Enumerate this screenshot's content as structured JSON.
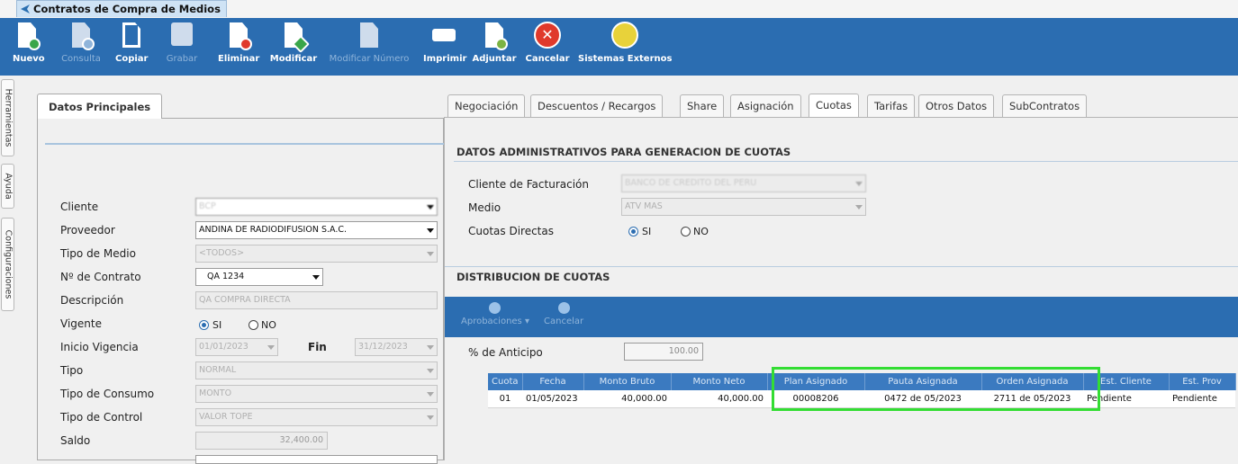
{
  "window": {
    "title": "Contratos de Compra de Medios"
  },
  "toolbar": {
    "buttons": [
      {
        "label": "Nuevo",
        "icon": "new-document-icon",
        "enabled": true
      },
      {
        "label": "Consulta",
        "icon": "query-document-icon",
        "enabled": false
      },
      {
        "label": "Copiar",
        "icon": "copy-icon",
        "enabled": true
      },
      {
        "label": "Grabar",
        "icon": "save-icon",
        "enabled": false
      },
      {
        "label": "Eliminar",
        "icon": "delete-document-icon",
        "enabled": true
      },
      {
        "label": "Modificar",
        "icon": "edit-document-icon",
        "enabled": true
      },
      {
        "label": "Modificar Número",
        "icon": "edit-number-icon",
        "enabled": false
      },
      {
        "label": "Imprimir",
        "icon": "printer-icon",
        "enabled": true
      },
      {
        "label": "Adjuntar",
        "icon": "attach-icon",
        "enabled": true
      },
      {
        "label": "Cancelar",
        "icon": "cancel-icon",
        "enabled": true
      },
      {
        "label": "Sistemas Externos",
        "icon": "external-systems-icon",
        "enabled": true
      }
    ]
  },
  "sidebar": {
    "tabs": [
      "Herramientas",
      "Ayuda",
      "Configuraciones"
    ]
  },
  "left_panel": {
    "tab": "Datos Principales",
    "fields": {
      "cliente": {
        "label": "Cliente",
        "value": "BCP"
      },
      "proveedor": {
        "label": "Proveedor",
        "value": "ANDINA DE RADIODIFUSION S.A.C."
      },
      "tipo_medio": {
        "label": "Tipo de Medio",
        "value": "<TODOS>"
      },
      "nro_contrato": {
        "label": "Nº de Contrato",
        "value": "QA 1234"
      },
      "descripcion": {
        "label": "Descripción",
        "value": "QA COMPRA DIRECTA"
      },
      "vigente": {
        "label": "Vigente",
        "yes": "SI",
        "no": "NO",
        "selected": "SI"
      },
      "inicio_vigencia": {
        "label": "Inicio Vigencia",
        "value": "01/01/2023"
      },
      "fin": {
        "label": "Fin",
        "value": "31/12/2023"
      },
      "tipo": {
        "label": "Tipo",
        "value": "NORMAL"
      },
      "tipo_consumo": {
        "label": "Tipo de Consumo",
        "value": "MONTO"
      },
      "tipo_control": {
        "label": "Tipo de Control",
        "value": "VALOR TOPE"
      },
      "saldo": {
        "label": "Saldo",
        "value": "32,400.00"
      }
    }
  },
  "right_panel": {
    "tabs": [
      "Negociación",
      "Descuentos / Recargos",
      "Share",
      "Asignación",
      "Cuotas",
      "Tarifas",
      "Otros Datos",
      "SubContratos"
    ],
    "active_tab": "Cuotas",
    "admin_section": {
      "title": "DATOS ADMINISTRATIVOS PARA GENERACION DE CUOTAS",
      "cliente_facturacion": {
        "label": "Cliente de Facturación",
        "value": "BANCO DE CREDITO DEL PERU"
      },
      "medio": {
        "label": "Medio",
        "value": "ATV MAS"
      },
      "cuotas_directas": {
        "label": "Cuotas Directas",
        "yes": "SI",
        "no": "NO",
        "selected": "SI"
      }
    },
    "distribution_section": {
      "title": "DISTRIBUCION DE CUOTAS",
      "actions": [
        {
          "label": "Aprobaciones ▾",
          "icon": "approvals-icon"
        },
        {
          "label": "Cancelar",
          "icon": "cancel-icon"
        }
      ],
      "anticipo": {
        "label": "% de Anticipo",
        "value": "100.00"
      },
      "grid": {
        "columns": [
          "Cuota",
          "Fecha",
          "Monto Bruto",
          "Monto Neto",
          "Plan Asignado",
          "Pauta Asignada",
          "Orden Asignada",
          "Est. Cliente",
          "Est. Prov"
        ],
        "rows": [
          [
            "01",
            "01/05/2023",
            "40,000.00",
            "40,000.00",
            "00008206",
            "0472 de 05/2023",
            "2711 de 05/2023",
            "Pendiente",
            "Pendiente"
          ]
        ]
      }
    }
  },
  "colors": {
    "toolbar_bg": "#2b6db1",
    "grid_header": "#3b7ac0",
    "highlight": "#33dd33"
  }
}
